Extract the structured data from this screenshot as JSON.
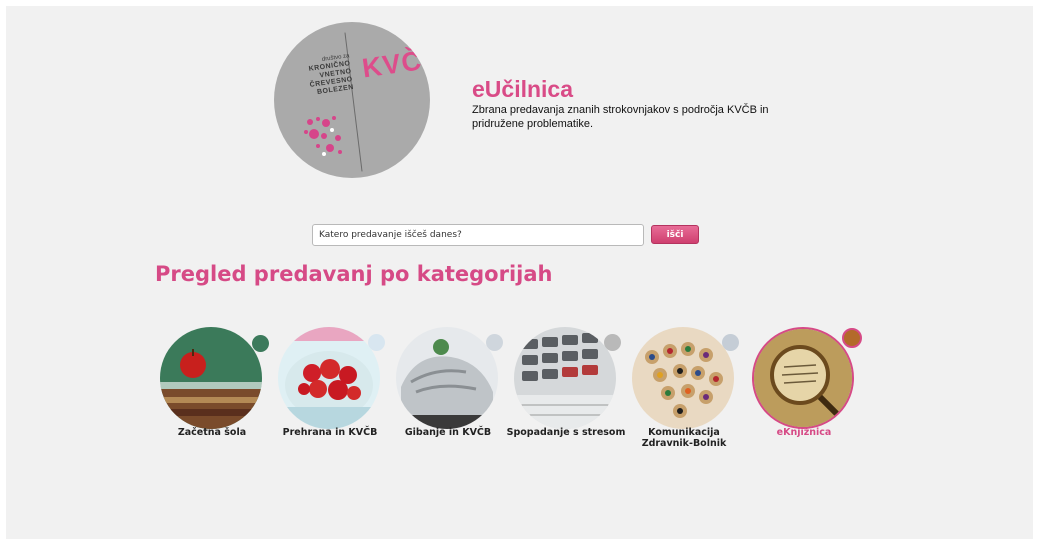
{
  "logo": {
    "brand": "KVČB",
    "society_small": "društvo za",
    "society_lines": [
      "KRONIČNO",
      "VNETNO",
      "ČREVESNO",
      "BOLEZEN"
    ]
  },
  "header": {
    "title": "eUčilnica",
    "description": "Zbrana predavanja znanih strokovnjakov s področja KVČB in pridružene problematike."
  },
  "search": {
    "placeholder": "Katero predavanje iščeš danes?",
    "button_label": "išči"
  },
  "section_title": "Pregled predavanj po kategorijah",
  "categories": [
    {
      "label": "Začetna šola",
      "icon": "apple-books-icon"
    },
    {
      "label": "Prehrana in KVČB",
      "icon": "strawberries-icon"
    },
    {
      "label": "Gibanje in KVČB",
      "icon": "sneaker-icon"
    },
    {
      "label": "Spopadanje s stresom",
      "icon": "calculator-icon"
    },
    {
      "label": "Komunikacija Zdravnik-Bolnik",
      "icon": "pencils-icon"
    },
    {
      "label": "eKnjižnica",
      "icon": "magnifier-book-icon"
    }
  ],
  "colors": {
    "accent": "#d64a86",
    "background": "#f1f1f1",
    "logo_gray": "#aaaaaa"
  }
}
